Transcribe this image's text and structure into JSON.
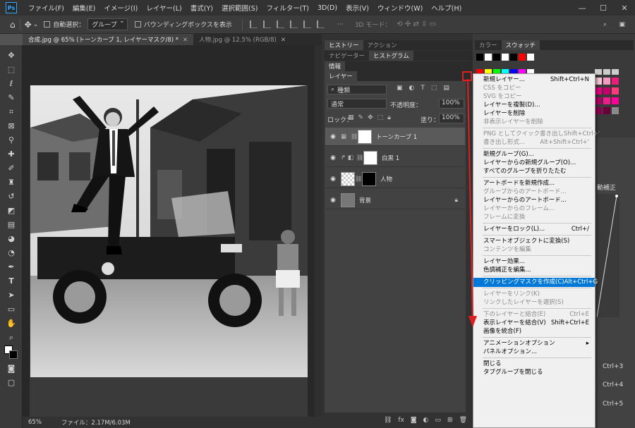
{
  "menubar": {
    "logo": "Ps",
    "items": [
      "ファイル(F)",
      "編集(E)",
      "イメージ(I)",
      "レイヤー(L)",
      "書式(Y)",
      "選択範囲(S)",
      "フィルター(T)",
      "3D(D)",
      "表示(V)",
      "ウィンドウ(W)",
      "ヘルプ(H)"
    ],
    "min": "—",
    "max": "☐",
    "close": "✕"
  },
  "options": {
    "auto_select_label": "自動選択：",
    "auto_select_value": "グループ",
    "bbox_label": "バウンディングボックスを表示",
    "mode_3d": "3D モード："
  },
  "tabs": [
    {
      "label": "合成.jpg @ 65% (トーンカーブ 1, レイヤーマスク/8) *",
      "active": true
    },
    {
      "label": "人物.jpg @ 12.5% (RGB/8)",
      "active": false
    }
  ],
  "status": {
    "zoom": "65%",
    "file": "ファイル：2.17M/6.03M"
  },
  "panels": {
    "row1": [
      "ヒストリー",
      "アクション"
    ],
    "row2": [
      "ナビゲーター",
      "ヒストグラム"
    ],
    "row3": [
      "情報"
    ],
    "row4": [
      "レイヤー"
    ],
    "right_tabs": [
      "カラー",
      "スウォッチ"
    ]
  },
  "layers": {
    "filter_kind": "種類",
    "blend_mode": "通常",
    "opacity_label": "不透明度：",
    "opacity_value": "100%",
    "lock_label": "ロック：",
    "fill_label": "塗り：",
    "fill_value": "100%",
    "items": [
      {
        "name": "トーンカーブ 1",
        "selected": true
      },
      {
        "name": "白黒 1",
        "selected": false
      },
      {
        "name": "人物",
        "selected": false
      },
      {
        "name": "背景",
        "selected": false
      }
    ],
    "footer_fx": "fx"
  },
  "right_strip": {
    "label": "動補正",
    "shortcuts": [
      "Ctrl+3",
      "Ctrl+4",
      "Ctrl+5"
    ]
  },
  "context_menu": {
    "items": [
      {
        "label": "新規レイヤー...",
        "shortcut": "Shift+Ctrl+N",
        "disabled": false
      },
      {
        "label": "CSS をコピー",
        "shortcut": "",
        "disabled": true
      },
      {
        "label": "SVG をコピー",
        "shortcut": "",
        "disabled": true
      },
      {
        "label": "レイヤーを複製(D)...",
        "shortcut": "",
        "disabled": false
      },
      {
        "label": "レイヤーを削除",
        "shortcut": "",
        "disabled": false
      },
      {
        "label": "非表示レイヤーを削除",
        "shortcut": "",
        "disabled": true
      },
      {
        "sep": true
      },
      {
        "label": "PNG としてクイック書き出し",
        "shortcut": "Shift+Ctrl+'",
        "disabled": true
      },
      {
        "label": "書き出し形式...",
        "shortcut": "Alt+Shift+Ctrl+'",
        "disabled": true
      },
      {
        "sep": true
      },
      {
        "label": "新規グループ(G)...",
        "shortcut": "",
        "disabled": false
      },
      {
        "label": "レイヤーからの新規グループ(O)...",
        "shortcut": "",
        "disabled": false
      },
      {
        "label": "すべてのグループを折りたたむ",
        "shortcut": "",
        "disabled": false
      },
      {
        "sep": true
      },
      {
        "label": "アートボードを新規作成...",
        "shortcut": "",
        "disabled": false
      },
      {
        "label": "グループからのアートボード...",
        "shortcut": "",
        "disabled": true
      },
      {
        "label": "レイヤーからのアートボード...",
        "shortcut": "",
        "disabled": false
      },
      {
        "label": "レイヤーからのフレーム...",
        "shortcut": "",
        "disabled": true
      },
      {
        "label": "フレームに変換",
        "shortcut": "",
        "disabled": true
      },
      {
        "sep": true
      },
      {
        "label": "レイヤーをロック(L)...",
        "shortcut": "Ctrl+/",
        "disabled": false
      },
      {
        "sep": true
      },
      {
        "label": "スマートオブジェクトに変換(S)",
        "shortcut": "",
        "disabled": false
      },
      {
        "label": "コンテンツを編集",
        "shortcut": "",
        "disabled": true
      },
      {
        "sep": true
      },
      {
        "label": "レイヤー効果...",
        "shortcut": "",
        "disabled": false
      },
      {
        "label": "色調補正を編集...",
        "shortcut": "",
        "disabled": false
      },
      {
        "sep": true
      },
      {
        "label": "クリッピングマスクを作成(C)",
        "shortcut": "Alt+Ctrl+G",
        "disabled": false,
        "highlight": true
      },
      {
        "sep": true
      },
      {
        "label": "レイヤーをリンク(K)",
        "shortcut": "",
        "disabled": true
      },
      {
        "label": "リンクしたレイヤーを選択(S)",
        "shortcut": "",
        "disabled": true
      },
      {
        "sep": true
      },
      {
        "label": "下のレイヤーと結合(E)",
        "shortcut": "Ctrl+E",
        "disabled": true
      },
      {
        "label": "表示レイヤーを結合(V)",
        "shortcut": "Shift+Ctrl+E",
        "disabled": false
      },
      {
        "label": "画像を統合(F)",
        "shortcut": "",
        "disabled": false
      },
      {
        "sep": true
      },
      {
        "label": "アニメーションオプション",
        "shortcut": "▸",
        "disabled": false
      },
      {
        "label": "パネルオプション...",
        "shortcut": "",
        "disabled": false
      },
      {
        "sep": true
      },
      {
        "label": "閉じる",
        "shortcut": "",
        "disabled": false
      },
      {
        "label": "タブグループを閉じる",
        "shortcut": "",
        "disabled": false
      }
    ]
  },
  "colors": {
    "accent": "#0078d7",
    "annotation": "#e02020"
  }
}
